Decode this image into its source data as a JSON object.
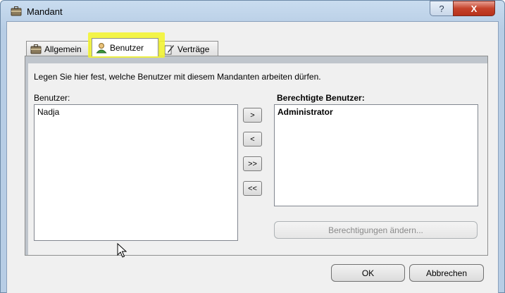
{
  "window": {
    "title": "Mandant",
    "help_glyph": "?",
    "close_glyph": "X"
  },
  "tabs": [
    {
      "label": "Allgemein",
      "icon": "briefcase-icon"
    },
    {
      "label": "Benutzer",
      "icon": "user-icon",
      "selected": true
    },
    {
      "label": "Verträge",
      "icon": "pen-icon"
    }
  ],
  "panel": {
    "description": "Legen Sie hier fest, welche Benutzer mit diesem Mandanten arbeiten dürfen.",
    "users_label": "Benutzer:",
    "users": [
      "Nadja"
    ],
    "authorized_label": "Berechtigte Benutzer:",
    "authorized_users": [
      "Administrator"
    ],
    "move_buttons": [
      ">",
      "<",
      ">>",
      "<<"
    ],
    "permissions_button": "Berechtigungen ändern..."
  },
  "footer": {
    "ok_label": "OK",
    "cancel_label": "Abbrechen"
  },
  "colors": {
    "highlight": "#f3f52a",
    "close_button": "#c5432b"
  }
}
